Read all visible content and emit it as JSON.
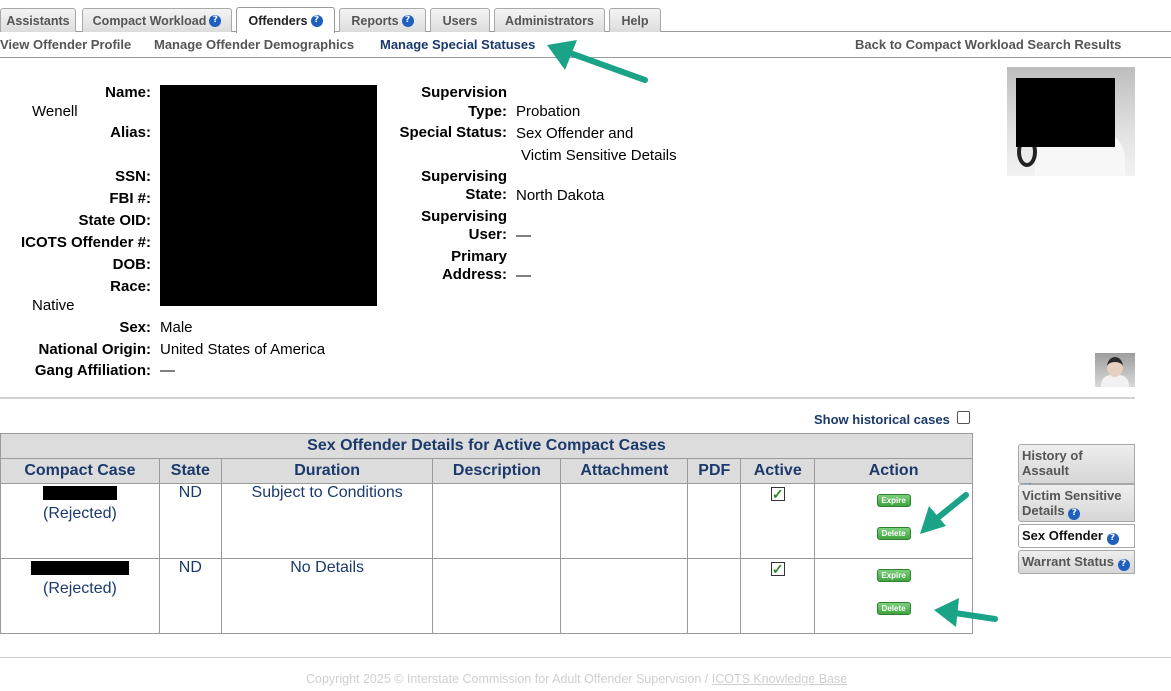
{
  "tabs": [
    {
      "label": "Assistants",
      "help": false,
      "active": false
    },
    {
      "label": "Compact Workload",
      "help": true,
      "active": false
    },
    {
      "label": "Offenders",
      "help": true,
      "active": true
    },
    {
      "label": "Reports",
      "help": true,
      "active": false
    },
    {
      "label": "Users",
      "help": false,
      "active": false
    },
    {
      "label": "Administrators",
      "help": false,
      "active": false
    },
    {
      "label": "Help",
      "help": false,
      "active": false
    }
  ],
  "subnav": {
    "view_profile": "View Offender Profile",
    "demographics": "Manage Offender Demographics",
    "special_statuses": "Manage Special Statuses",
    "back": "Back to Compact Workload Search Results"
  },
  "profile": {
    "name_label": "Name:",
    "name_partial": "Wenell",
    "alias_label": "Alias:",
    "ssn_label": "SSN:",
    "fbi_label": "FBI #:",
    "state_oid_label": "State OID:",
    "icots_label": "ICOTS Offender #:",
    "dob_label": "DOB:",
    "race_label": "Race:",
    "race_partial": "Native",
    "sex_label": "Sex:",
    "sex": "Male",
    "origin_label": "National Origin:",
    "origin": "United States of America",
    "gang_label": "Gang Affiliation:",
    "gang": "—"
  },
  "supervision": {
    "type_label_1": "Supervision",
    "type_label_2": "Type:",
    "type": "Probation",
    "special_label": "Special Status:",
    "special_1": "Sex Offender and",
    "special_2": "Victim Sensitive Details",
    "state_label_1": "Supervising",
    "state_label_2": "State:",
    "state": "North Dakota",
    "user_label_1": "Supervising",
    "user_label_2": "User:",
    "user": "—",
    "address_label_1": "Primary",
    "address_label_2": "Address:",
    "address": "—"
  },
  "show_historical": "Show historical cases",
  "table": {
    "caption": "Sex Offender Details for Active Compact Cases",
    "headers": [
      "Compact Case",
      "State",
      "Duration",
      "Description",
      "Attachment",
      "PDF",
      "Active",
      "Action"
    ],
    "rows": [
      {
        "status": "(Rejected)",
        "state": "ND",
        "duration": "Subject to Conditions",
        "description": "",
        "attachment": "",
        "pdf": "",
        "active": true,
        "expire": "Expire",
        "delete": "Delete"
      },
      {
        "status": "(Rejected)",
        "state": "ND",
        "duration": "No Details",
        "description": "",
        "attachment": "",
        "pdf": "",
        "active": true,
        "expire": "Expire",
        "delete": "Delete"
      }
    ]
  },
  "side_tabs": [
    {
      "label": "History of Assault",
      "help": true,
      "active": false
    },
    {
      "label": "Victim Sensitive Details",
      "help": true,
      "active": false
    },
    {
      "label": "Sex Offender",
      "help": true,
      "active": true
    },
    {
      "label": "Warrant Status",
      "help": true,
      "active": false
    }
  ],
  "footer": {
    "copyright": "Copyright 2025 © Interstate Commission for Adult Offender Supervision / ",
    "kb_link": "ICOTS Knowledge Base"
  },
  "colors": {
    "link": "#1b3a6b",
    "arrow": "#1aa387",
    "help_icon": "#1f5fbf",
    "action_button": "#3fa43f"
  }
}
